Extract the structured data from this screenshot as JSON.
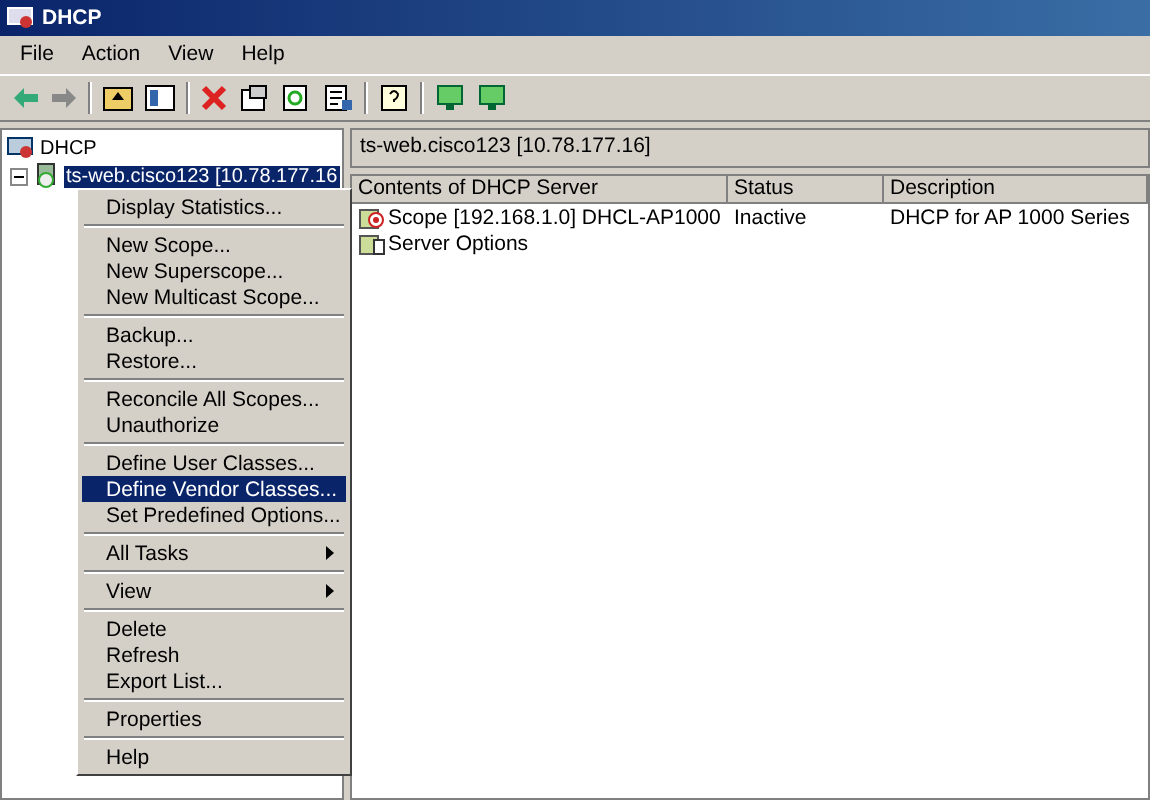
{
  "window": {
    "title": "DHCP"
  },
  "menu_bar": [
    "File",
    "Action",
    "View",
    "Help"
  ],
  "tree": [
    {
      "label": "DHCP",
      "selected": false,
      "children": [
        {
          "label": "ts-web.cisco123 [10.78.177.16",
          "selected": true,
          "expanded": true
        }
      ]
    }
  ],
  "details": {
    "header": "ts-web.cisco123 [10.78.177.16]",
    "columns": [
      "Contents of DHCP Server",
      "Status",
      "Description"
    ],
    "rows": [
      {
        "kind": "scope",
        "cells": [
          "Scope [192.168.1.0] DHCL-AP1000",
          "Inactive",
          "DHCP for AP 1000 Series"
        ]
      },
      {
        "kind": "folder",
        "cells": [
          "Server Options",
          "",
          ""
        ]
      }
    ]
  },
  "context_menu": [
    [
      {
        "label": "Display Statistics...",
        "selected": false,
        "submenu": false
      }
    ],
    [
      {
        "label": "New Scope...",
        "selected": false,
        "submenu": false
      },
      {
        "label": "New Superscope...",
        "selected": false,
        "submenu": false
      },
      {
        "label": "New Multicast Scope...",
        "selected": false,
        "submenu": false
      }
    ],
    [
      {
        "label": "Backup...",
        "selected": false,
        "submenu": false
      },
      {
        "label": "Restore...",
        "selected": false,
        "submenu": false
      }
    ],
    [
      {
        "label": "Reconcile All Scopes...",
        "selected": false,
        "submenu": false
      },
      {
        "label": "Unauthorize",
        "selected": false,
        "submenu": false
      }
    ],
    [
      {
        "label": "Define User Classes...",
        "selected": false,
        "submenu": false
      },
      {
        "label": "Define Vendor Classes...",
        "selected": true,
        "submenu": false
      },
      {
        "label": "Set Predefined Options...",
        "selected": false,
        "submenu": false
      }
    ],
    [
      {
        "label": "All Tasks",
        "selected": false,
        "submenu": true
      }
    ],
    [
      {
        "label": "View",
        "selected": false,
        "submenu": true
      }
    ],
    [
      {
        "label": "Delete",
        "selected": false,
        "submenu": false
      },
      {
        "label": "Refresh",
        "selected": false,
        "submenu": false
      },
      {
        "label": "Export List...",
        "selected": false,
        "submenu": false
      }
    ],
    [
      {
        "label": "Properties",
        "selected": false,
        "submenu": false
      }
    ],
    [
      {
        "label": "Help",
        "selected": false,
        "submenu": false
      }
    ]
  ]
}
